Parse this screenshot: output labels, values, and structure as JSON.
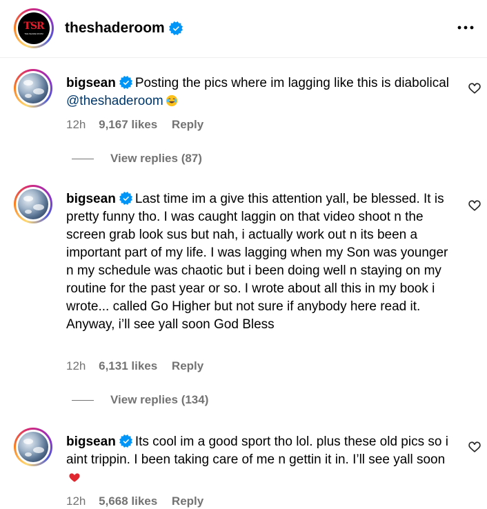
{
  "post": {
    "username": "theshaderoom",
    "avatar_text": "TSR",
    "avatar_sub": "THE SHADE ROOM",
    "more_icon": "more-horizontal-icon"
  },
  "colors": {
    "mention": "#00376b",
    "verified": "#0095f6",
    "muted": "#737373",
    "heart_emoji": "#e0272f"
  },
  "comments": [
    {
      "username": "bigsean",
      "text": "Posting the pics where im lagging like this is diabolical ",
      "mention": "@theshaderoom",
      "emoji": "joy-emoji",
      "time": "12h",
      "likes": "9,167 likes",
      "reply": "Reply",
      "view_replies": "View replies (87)"
    },
    {
      "username": "bigsean",
      "text": "Last time im a give this attention yall, be blessed. It is pretty funny tho. I was caught laggin on that video shoot n the screen grab look sus but nah, i actually work out n its been a important part of my life. I was lagging when my Son was younger n my schedule was chaotic but i been doing well n staying on my routine for the past year or so. I wrote about all this in my book i wrote... called Go Higher but not sure if anybody here read it. Anyway, i’ll see yall soon God Bless",
      "time": "12h",
      "likes": "6,131 likes",
      "reply": "Reply",
      "view_replies": "View replies (134)"
    },
    {
      "username": "bigsean",
      "text": "Its cool im a good sport tho lol. plus these old pics so i aint trippin. I been taking care of me n gettin it in. I’ll see yall soon ",
      "emoji": "red-heart-emoji",
      "time": "12h",
      "likes": "5,668 likes",
      "reply": "Reply"
    }
  ]
}
